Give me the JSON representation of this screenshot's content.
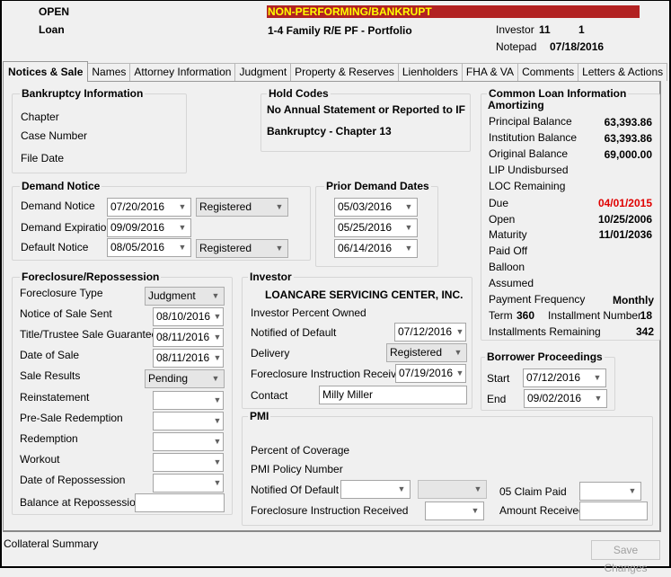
{
  "header": {
    "status": "OPEN",
    "type_label": "Loan",
    "alert_banner": "NON-PERFORMING/BANKRUPT",
    "loan_type": "1-4 Family R/E PF - Portfolio",
    "investor_label": "Investor",
    "investor_code1": "11",
    "investor_code2": "1",
    "notepad_label": "Notepad",
    "notepad_date": "07/18/2016",
    "colors": {
      "banner_bg": "#b22222",
      "banner_text": "#ffff00"
    }
  },
  "tabs": [
    {
      "label": "Notices & Sale",
      "active": true
    },
    {
      "label": "Names"
    },
    {
      "label": "Attorney Information"
    },
    {
      "label": "Judgment"
    },
    {
      "label": "Property & Reserves"
    },
    {
      "label": "Lienholders"
    },
    {
      "label": "FHA & VA"
    },
    {
      "label": "Comments"
    },
    {
      "label": "Letters & Actions"
    }
  ],
  "bankruptcy": {
    "title": "Bankruptcy Information",
    "chapter_label": "Chapter",
    "case_number_label": "Case Number",
    "file_date_label": "File Date"
  },
  "hold_codes": {
    "title": "Hold Codes",
    "items": [
      "No Annual Statement or Reported to IF",
      "Bankruptcy - Chapter 13"
    ]
  },
  "demand_notice": {
    "title": "Demand Notice",
    "rows": [
      {
        "label": "Demand Notice",
        "date": "07/20/2016",
        "delivery": "Registered"
      },
      {
        "label": "Demand Expiration",
        "date": "09/09/2016"
      },
      {
        "label": "Default Notice",
        "date": "08/05/2016",
        "delivery": "Registered"
      }
    ]
  },
  "prior_demand": {
    "title": "Prior Demand Dates",
    "dates": [
      "05/03/2016",
      "05/25/2016",
      "06/14/2016"
    ]
  },
  "common_loan": {
    "title": "Common Loan Information",
    "subtitle": "Amortizing",
    "rows": [
      {
        "label": "Principal Balance",
        "value": "63,393.86"
      },
      {
        "label": "Institution Balance",
        "value": "63,393.86"
      },
      {
        "label": "Original Balance",
        "value": "69,000.00"
      },
      {
        "label": "LIP Undisbursed",
        "value": ""
      },
      {
        "label": "LOC Remaining",
        "value": ""
      },
      {
        "label": "Due",
        "value": "04/01/2015",
        "color": "#e00000"
      },
      {
        "label": "Open",
        "value": "10/25/2006"
      },
      {
        "label": "Maturity",
        "value": "11/01/2036"
      },
      {
        "label": "Paid Off",
        "value": ""
      },
      {
        "label": "Balloon",
        "value": ""
      },
      {
        "label": "Assumed",
        "value": ""
      },
      {
        "label": "Payment Frequency",
        "value": "Monthly"
      }
    ],
    "term_label": "Term",
    "term_value": "360",
    "installment_number_label": "Installment Number",
    "installment_number_value": "18",
    "installments_remaining_label": "Installments Remaining",
    "installments_remaining_value": "342"
  },
  "borrower_proceedings": {
    "title": "Borrower Proceedings",
    "start_label": "Start",
    "start_date": "07/12/2016",
    "end_label": "End",
    "end_date": "09/02/2016"
  },
  "foreclosure": {
    "title": "Foreclosure/Repossession",
    "rows": [
      {
        "label": "Foreclosure Type",
        "value": "Judgment"
      },
      {
        "label": "Notice of Sale Sent",
        "value": "08/10/2016"
      },
      {
        "label": "Title/Trustee Sale Guarantee",
        "value": "08/11/2016"
      },
      {
        "label": "Date of Sale",
        "value": "08/11/2016"
      },
      {
        "label": "Sale Results",
        "value": "Pending"
      },
      {
        "label": "Reinstatement",
        "value": ""
      },
      {
        "label": "Pre-Sale Redemption",
        "value": ""
      },
      {
        "label": "Redemption",
        "value": ""
      },
      {
        "label": "Workout",
        "value": ""
      },
      {
        "label": "Date of Repossession",
        "value": ""
      },
      {
        "label": "Balance at Repossession",
        "value": ""
      }
    ]
  },
  "investor": {
    "title": "Investor",
    "name": "LOANCARE SERVICING CENTER, INC.",
    "percent_owned_label": "Investor Percent Owned",
    "notified_label": "Notified of Default",
    "notified_date": "07/12/2016",
    "delivery_label": "Delivery",
    "delivery_value": "Registered",
    "fc_instruction_label": "Foreclosure Instruction Received",
    "fc_instruction_date": "07/19/2016",
    "contact_label": "Contact",
    "contact_value": "Milly Miller"
  },
  "pmi": {
    "title": "PMI",
    "percent_label": "Percent of Coverage",
    "policy_label": "PMI Policy Number",
    "notified_label": "Notified Of Default",
    "notified_value": "",
    "notified_value2": "",
    "claim_paid_label": "05 Claim Paid",
    "claim_paid_value": "",
    "fc_instruction_label": "Foreclosure Instruction Received",
    "fc_instruction_value": "",
    "amount_received_label": "Amount Received",
    "amount_received_value": ""
  },
  "footer": {
    "collateral_summary": "Collateral Summary",
    "save_button": "Save Changes"
  },
  "icons": {
    "dropdown": "chevron-down-icon"
  }
}
